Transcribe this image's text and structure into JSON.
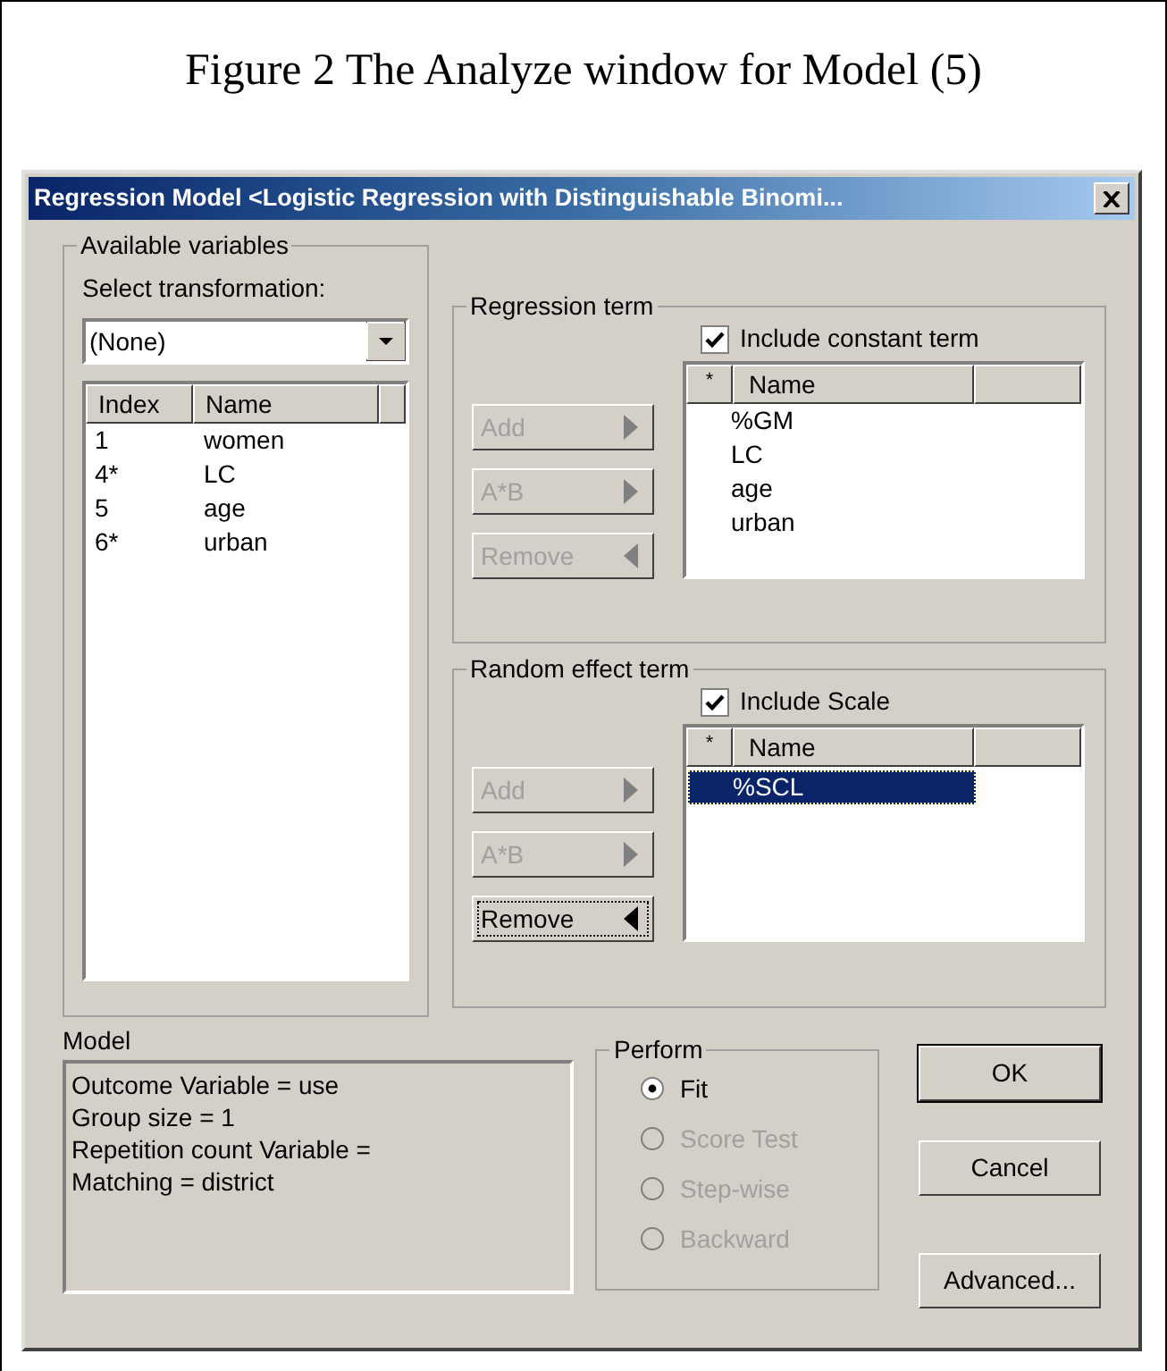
{
  "caption": "Figure 2 The Analyze window for Model (5)",
  "window": {
    "title": "Regression Model <Logistic Regression with Distinguishable Binomi..."
  },
  "available_variables": {
    "title": "Available variables",
    "transform_label": "Select transformation:",
    "transform_value": "(None)",
    "columns": [
      "Index",
      "Name"
    ],
    "rows": [
      {
        "index": "1",
        "name": "women"
      },
      {
        "index": "4*",
        "name": "LC"
      },
      {
        "index": "5",
        "name": "age"
      },
      {
        "index": "6*",
        "name": "urban"
      }
    ]
  },
  "regression_term": {
    "title": "Regression term",
    "include": {
      "label": "Include constant term",
      "checked": true
    },
    "buttons": [
      {
        "label": "Add",
        "kind": "right",
        "disabled": true,
        "focused": false
      },
      {
        "label": "A*B",
        "kind": "right",
        "disabled": true,
        "focused": false
      },
      {
        "label": "Remove",
        "kind": "left",
        "disabled": true,
        "focused": false
      }
    ],
    "columns": [
      "*",
      "Name"
    ],
    "rows": [
      {
        "name": "%GM",
        "selected": false
      },
      {
        "name": "LC",
        "selected": false
      },
      {
        "name": "age",
        "selected": false
      },
      {
        "name": "urban",
        "selected": false
      }
    ]
  },
  "random_effect_term": {
    "title": "Random effect term",
    "include": {
      "label": "Include Scale",
      "checked": true
    },
    "buttons": [
      {
        "label": "Add",
        "kind": "right",
        "disabled": true,
        "focused": false
      },
      {
        "label": "A*B",
        "kind": "right",
        "disabled": true,
        "focused": false
      },
      {
        "label": "Remove",
        "kind": "left",
        "disabled": false,
        "focused": true
      }
    ],
    "columns": [
      "*",
      "Name"
    ],
    "rows": [
      {
        "name": "%SCL",
        "selected": true
      }
    ]
  },
  "model": {
    "label": "Model",
    "lines": [
      "Outcome Variable = use",
      "Group size = 1",
      "Repetition count Variable =",
      "Matching = district"
    ]
  },
  "perform": {
    "title": "Perform",
    "options": [
      {
        "label": "Fit",
        "selected": true,
        "disabled": false
      },
      {
        "label": "Score Test",
        "selected": false,
        "disabled": true
      },
      {
        "label": "Step-wise",
        "selected": false,
        "disabled": true
      },
      {
        "label": "Backward",
        "selected": false,
        "disabled": true
      }
    ]
  },
  "buttons": [
    {
      "label": "OK",
      "default": true
    },
    {
      "label": "Cancel",
      "default": false
    },
    {
      "label": "Advanced...",
      "default": false
    }
  ]
}
